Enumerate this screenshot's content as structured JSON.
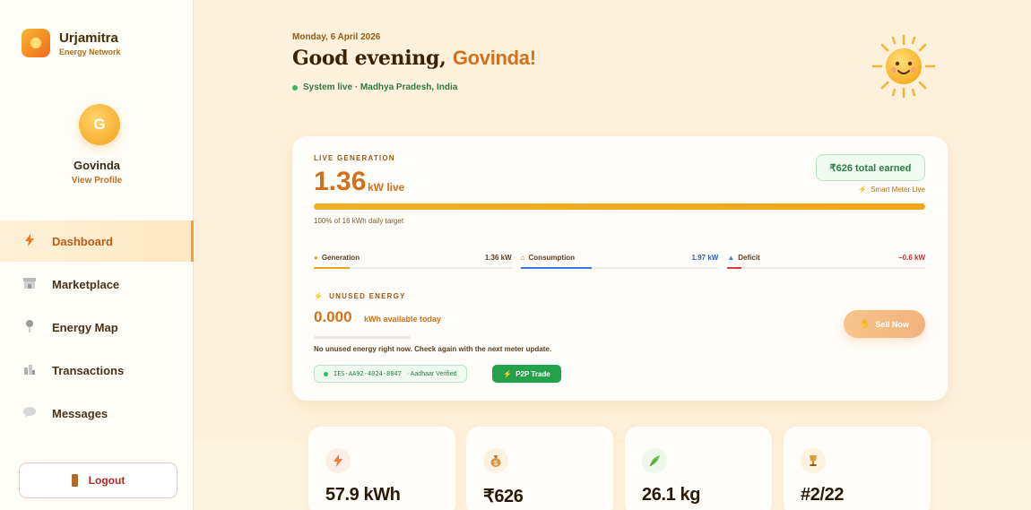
{
  "brand": {
    "name": "Urjamitra",
    "subtitle": "Energy Network"
  },
  "user": {
    "initial": "G",
    "name": "Govinda",
    "profile_link": "View Profile"
  },
  "nav": [
    {
      "label": "Dashboard",
      "icon": "lightning-icon",
      "active": true
    },
    {
      "label": "Marketplace",
      "icon": "store-icon",
      "active": false
    },
    {
      "label": "Energy Map",
      "icon": "map-pin-icon",
      "active": false
    },
    {
      "label": "Transactions",
      "icon": "bar-chart-icon",
      "active": false
    },
    {
      "label": "Messages",
      "icon": "chat-bubble-icon",
      "active": false
    }
  ],
  "logout_label": "Logout",
  "header": {
    "date": "Monday, 6 April 2026",
    "greeting_prefix": "Good evening,",
    "greeting_name": "Govinda!",
    "status": "System live · Madhya Pradesh, India"
  },
  "live": {
    "label": "LIVE GENERATION",
    "value": "1.36",
    "unit": "kW live",
    "earned": "₹626 total earned",
    "meter": "Smart Meter Live",
    "target_text": "100% of 16 kWh daily target",
    "target_fraction": 1.0
  },
  "metrics": [
    {
      "name": "Generation",
      "icon": "sun-icon",
      "value": "1.36 kW",
      "color": "#f0a21b",
      "value_color": "#5a4024",
      "fill": 0.18
    },
    {
      "name": "Consumption",
      "icon": "home-icon",
      "value": "1.97 kW",
      "color": "#3f78e0",
      "value_color": "#2f5fb8",
      "fill": 0.36
    },
    {
      "name": "Deficit",
      "icon": "meter-icon",
      "value": "−0.6 kW",
      "color": "#e23a3a",
      "value_color": "#d12c2c",
      "fill": 0.07
    }
  ],
  "unused": {
    "label": "UNUSED ENERGY",
    "value": "0.000",
    "unit": "kWh available today",
    "note": "No unused energy right now. Check again with the next meter update.",
    "sell_label": "Sell Now"
  },
  "tags": {
    "ies_id": "IES-AA92-4024-8847",
    "verified": "· Aadhaar Verified",
    "p2p": "P2P Trade"
  },
  "stats": [
    {
      "value": "57.9 kWh",
      "icon": "lightning-icon",
      "glyph": "⚡",
      "bg": "#fdeee6",
      "color": "#f07a3a"
    },
    {
      "value": "₹626",
      "icon": "money-bag-icon",
      "glyph": "💰",
      "bg": "#fdf1e0",
      "color": "#c8822a"
    },
    {
      "value": "26.1 kg",
      "icon": "leaf-icon",
      "glyph": "🌿",
      "bg": "#edf7ea",
      "color": "#6fb35a"
    },
    {
      "value": "#2/22",
      "icon": "trophy-icon",
      "glyph": "🏆",
      "bg": "#fdf1e0",
      "color": "#c8922a"
    }
  ],
  "colors": {
    "accent": "#d2701b",
    "live_green": "#2fbf5a",
    "p2p_green": "#23a249"
  }
}
